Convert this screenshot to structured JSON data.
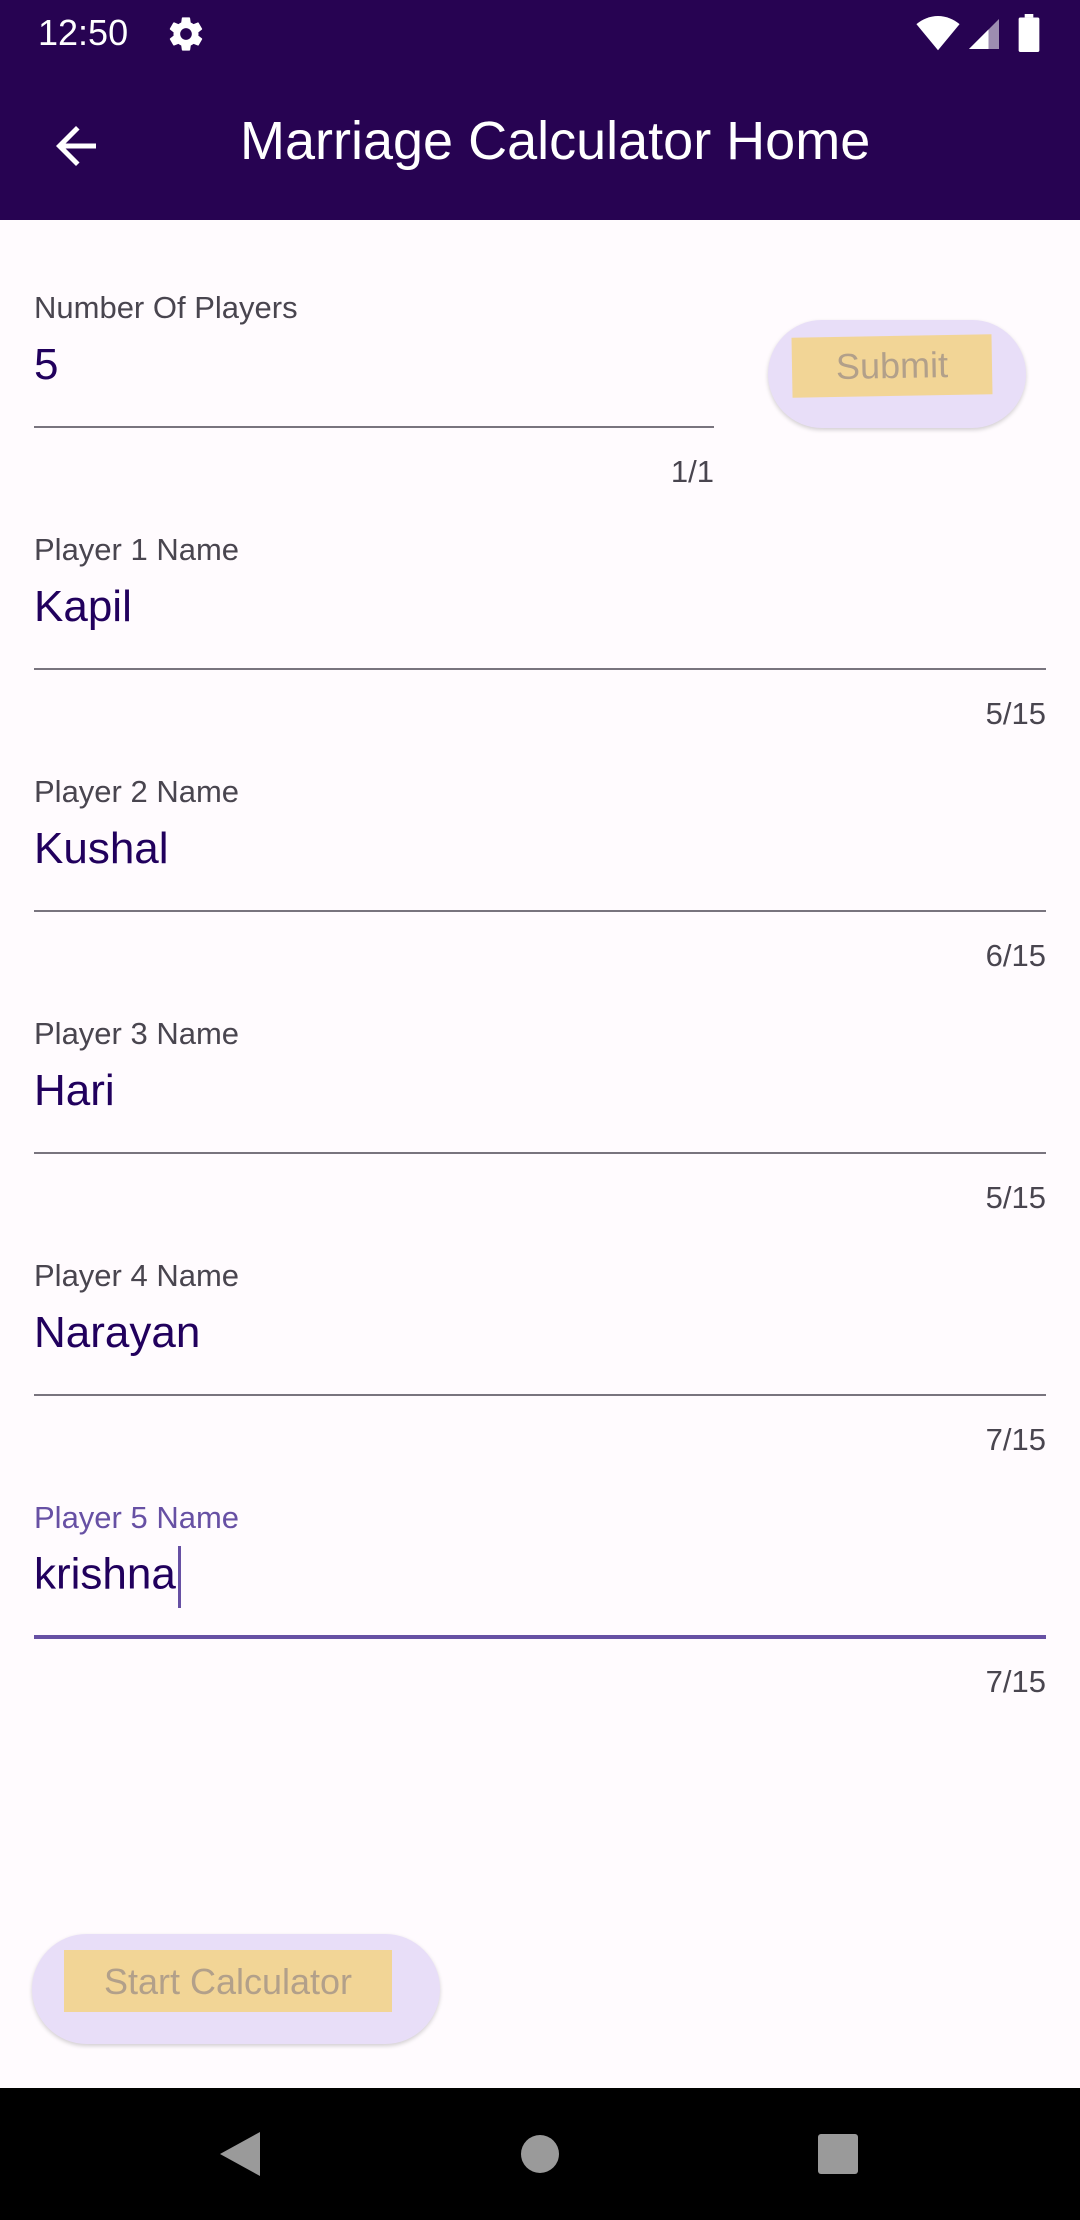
{
  "status": {
    "time": "12:50",
    "icons": [
      "gear-icon",
      "wifi-icon",
      "signal-icon",
      "battery-icon"
    ]
  },
  "appbar": {
    "title": "Marriage Calculator Home",
    "back_icon": "arrow-back-icon"
  },
  "players_count": {
    "label": "Number Of Players",
    "value": "5",
    "counter": "1/1"
  },
  "submit_button": {
    "label": "Submit"
  },
  "players": [
    {
      "label": "Player 1 Name",
      "value": "Kapil",
      "counter": "5/15"
    },
    {
      "label": "Player 2 Name",
      "value": "Kushal",
      "counter": "6/15"
    },
    {
      "label": "Player 3 Name",
      "value": "Hari",
      "counter": "5/15"
    },
    {
      "label": "Player 4 Name",
      "value": "Narayan",
      "counter": "7/15"
    },
    {
      "label": "Player 5 Name",
      "value": "krishna",
      "counter": "7/15"
    }
  ],
  "start_button": {
    "label": "Start Calculator"
  },
  "colors": {
    "appbar": "#270352",
    "accent": "#6750a4",
    "button_bg": "#e8def8",
    "highlight": "#f2d596"
  }
}
